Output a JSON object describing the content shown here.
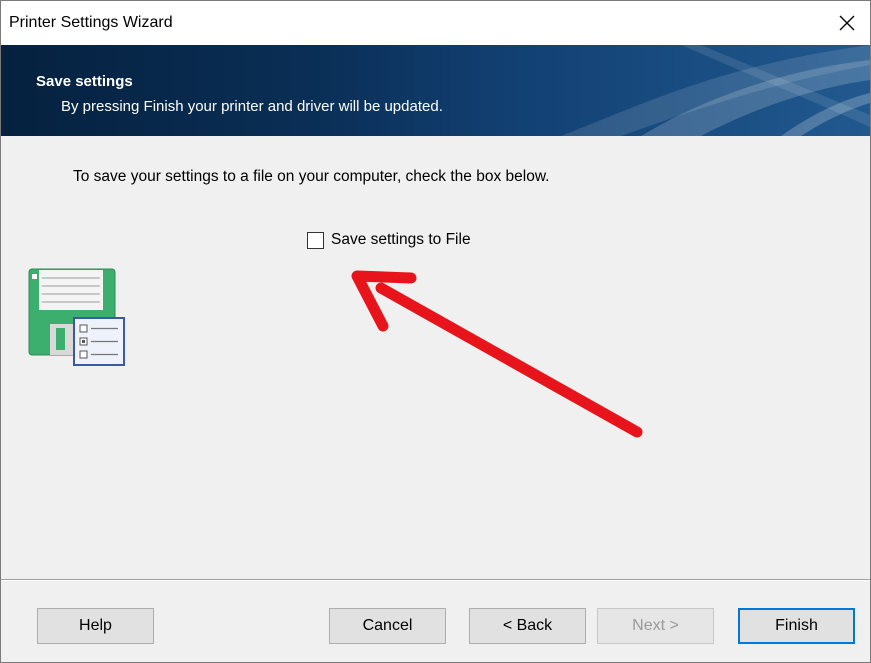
{
  "window": {
    "title": "Printer Settings Wizard",
    "close_icon": "close-icon"
  },
  "banner": {
    "title": "Save settings",
    "subtitle": "By pressing Finish your printer and driver will be updated."
  },
  "content": {
    "instruction": "To save your settings to a file on your computer, check the box below.",
    "checkbox": {
      "label": "Save settings to File",
      "checked": false
    },
    "icon": "save-to-file-icon",
    "annotation": "red-arrow-icon"
  },
  "buttons": {
    "help": "Help",
    "cancel": "Cancel",
    "back": "< Back",
    "next": "Next >",
    "finish": "Finish"
  },
  "colors": {
    "accent": "#0078d7",
    "banner": "#0a2e55",
    "annotation_arrow": "#e8141b"
  }
}
